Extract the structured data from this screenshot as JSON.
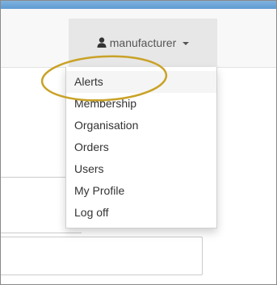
{
  "navbar": {
    "username": "manufacturer",
    "user_icon": "user-icon",
    "caret_icon": "caret-down-icon"
  },
  "dropdown": {
    "items": [
      {
        "label": "Alerts"
      },
      {
        "label": "Membership"
      },
      {
        "label": "Organisation"
      },
      {
        "label": "Orders"
      },
      {
        "label": "Users"
      },
      {
        "label": "My Profile"
      },
      {
        "label": "Log off"
      }
    ]
  },
  "colors": {
    "topbar": "#6fa8dc",
    "navbar_bg": "#f8f8f8",
    "toggle_bg": "#e7e7e7",
    "annotation": "#c9a227"
  }
}
